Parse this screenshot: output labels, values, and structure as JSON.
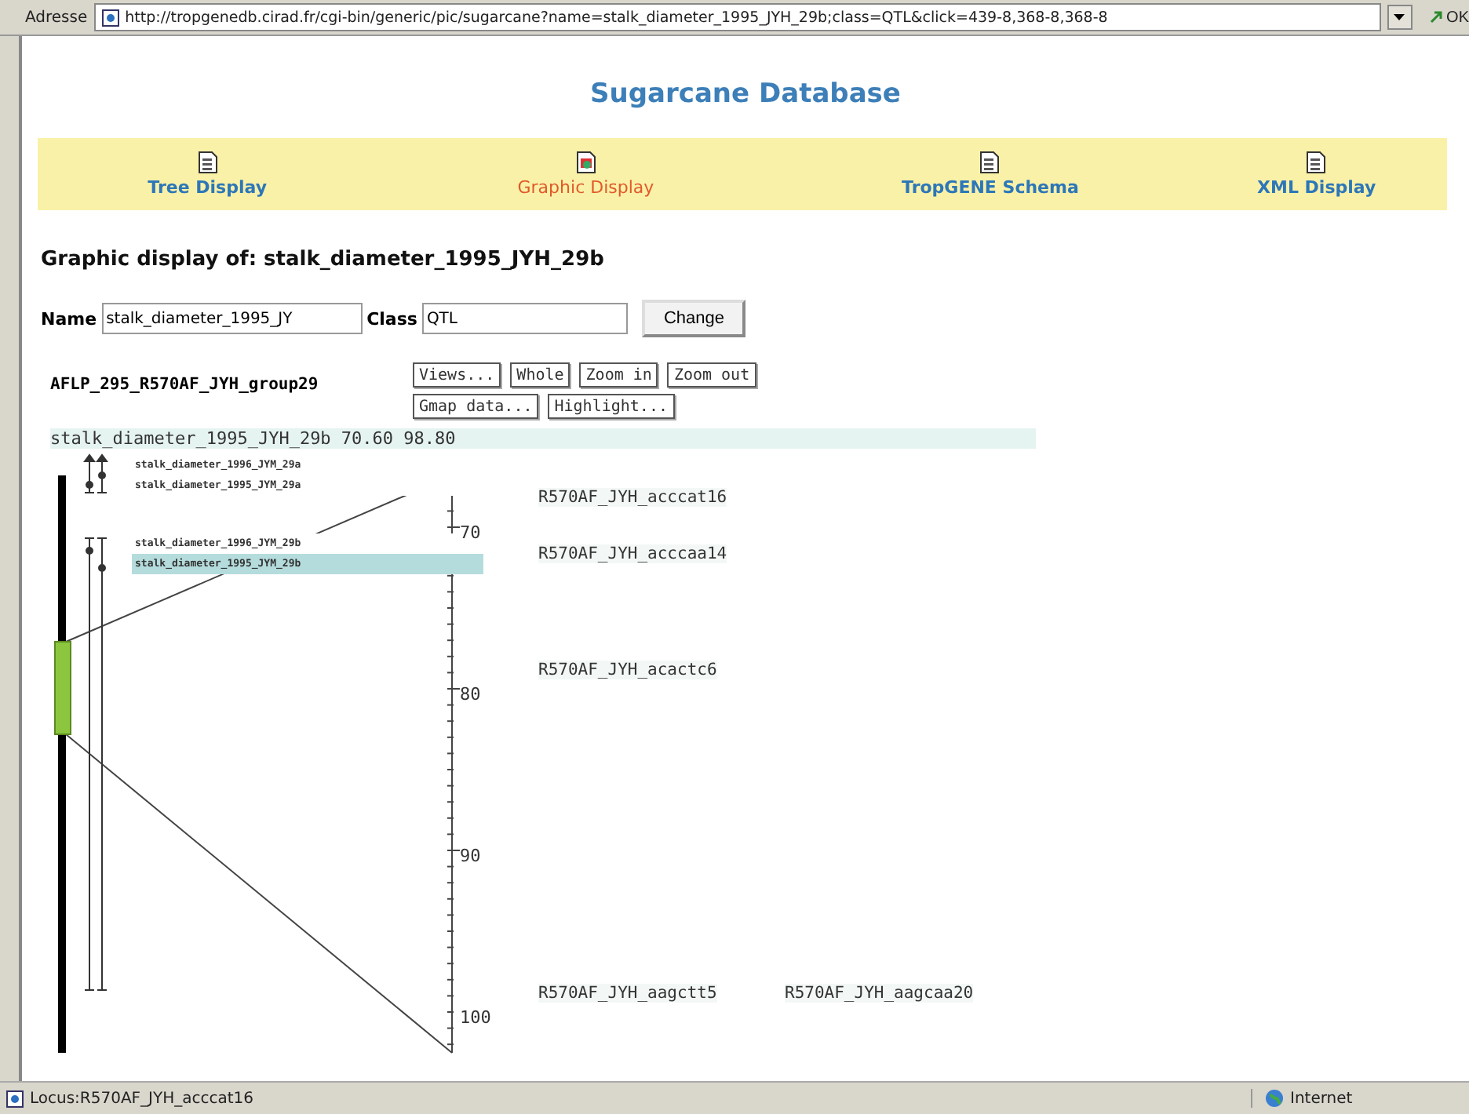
{
  "address_bar": {
    "label": "Adresse",
    "url": "http://tropgenedb.cirad.fr/cgi-bin/generic/pic/sugarcane?name=stalk_diameter_1995_JYH_29b;class=QTL&click=439-8,368-8,368-8",
    "go": "OK"
  },
  "title": "Sugarcane Database",
  "nav": [
    {
      "label": "Tree Display",
      "selected": false
    },
    {
      "label": "Graphic Display",
      "selected": true
    },
    {
      "label": "TropGENE Schema",
      "selected": false
    },
    {
      "label": "XML Display",
      "selected": false
    }
  ],
  "heading": "Graphic display of: stalk_diameter_1995_JYH_29b",
  "form": {
    "name_label": "Name",
    "name_value": "stalk_diameter_1995_JY",
    "class_label": "Class",
    "class_value": "QTL",
    "button": "Change"
  },
  "map": {
    "group": "AFLP_295_R570AF_JYH_group29",
    "buttons": [
      "Views...",
      "Whole",
      "Zoom in",
      "Zoom out",
      "Gmap data...",
      "Highlight..."
    ],
    "info": "stalk_diameter_1995_JYH_29b 70.60 98.80",
    "qtls": [
      {
        "label": "stalk_diameter_1996_JYM_29a",
        "selected": false
      },
      {
        "label": "stalk_diameter_1995_JYM_29a",
        "selected": false
      },
      {
        "label": "stalk_diameter_1996_JYM_29b",
        "selected": false
      },
      {
        "label": "stalk_diameter_1995_JYM_29b",
        "selected": true
      }
    ],
    "markers": [
      "R570AF_JYH_acccat16",
      "R570AF_JYH_acccaa14",
      "R570AF_JYH_acactc6",
      "R570AF_JYH_aagctt5",
      "R570AF_JYH_aagcaa20"
    ],
    "scale_labels": [
      "70",
      "80",
      "90",
      "100"
    ]
  },
  "status_bar": {
    "text": "Locus:R570AF_JYH_acccat16",
    "zone": "Internet"
  }
}
